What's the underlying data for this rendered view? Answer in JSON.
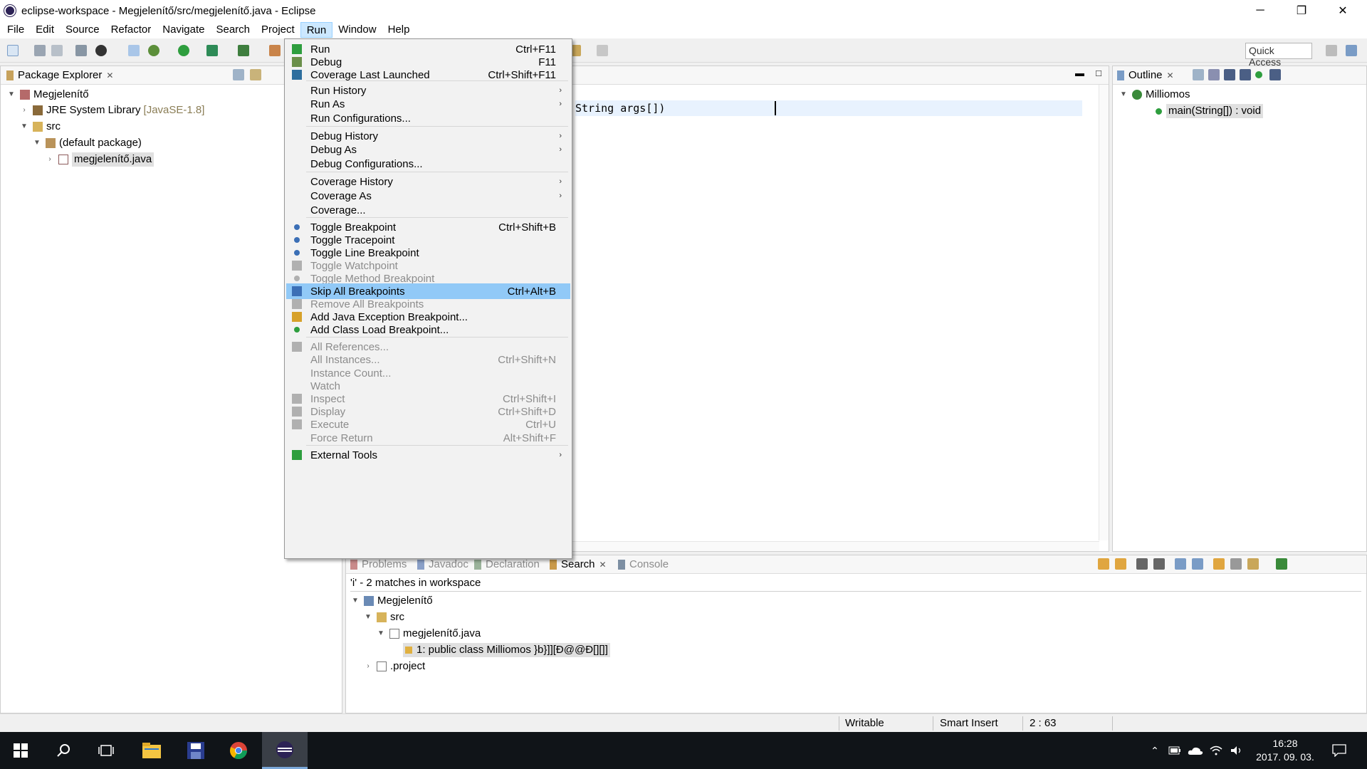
{
  "window": {
    "title": "eclipse-workspace - Megjelenítő/src/megjelenítő.java - Eclipse",
    "minimize": "─",
    "maximize": "❐",
    "close": "✕"
  },
  "menubar": [
    "File",
    "Edit",
    "Source",
    "Refactor",
    "Navigate",
    "Search",
    "Project",
    "Run",
    "Window",
    "Help"
  ],
  "toolbar": {
    "quick_access": "Quick Access"
  },
  "package_explorer": {
    "tab": "Package Explorer",
    "tree": {
      "project": "Megjelenítő",
      "jre": "JRE System Library",
      "jre_version": "[JavaSE-1.8]",
      "src": "src",
      "package": "(default package)",
      "file": "megjelenítő.java"
    }
  },
  "editor": {
    "visible_code": "String args[])"
  },
  "outline": {
    "tab": "Outline",
    "class": "Milliomos",
    "method": "main(String[]) : void"
  },
  "bottom_panel": {
    "tabs": [
      "Problems",
      "Javadoc",
      "Declaration",
      "Search",
      "Console"
    ],
    "summary": "'i' - 2 matches in workspace",
    "tree": {
      "project": "Megjelenítő",
      "src": "src",
      "file": "megjelenítő.java",
      "match": "1: public class Milliomos }b}]][Ð@@Ð[][]]",
      "project_file": ".project"
    }
  },
  "status": {
    "writable": "Writable",
    "insert_mode": "Smart Insert",
    "position": "2 : 63"
  },
  "run_menu": {
    "items": [
      {
        "label": "Run",
        "accel": "Ctrl+F11",
        "icon": "run-icon"
      },
      {
        "label": "Debug",
        "accel": "F11",
        "icon": "debug-icon"
      },
      {
        "label": "Coverage Last Launched",
        "accel": "Ctrl+Shift+F11",
        "icon": "coverage-icon"
      },
      {
        "label": "Run History",
        "submenu": true
      },
      {
        "label": "Run As",
        "submenu": true
      },
      {
        "label": "Run Configurations..."
      },
      {
        "label": "Debug History",
        "submenu": true
      },
      {
        "label": "Debug As",
        "submenu": true
      },
      {
        "label": "Debug Configurations..."
      },
      {
        "label": "Coverage History",
        "submenu": true
      },
      {
        "label": "Coverage As",
        "submenu": true
      },
      {
        "label": "Coverage..."
      },
      {
        "label": "Toggle Breakpoint",
        "accel": "Ctrl+Shift+B",
        "icon": "breakpoint-icon"
      },
      {
        "label": "Toggle Tracepoint",
        "icon": "tracepoint-icon"
      },
      {
        "label": "Toggle Line Breakpoint",
        "icon": "line-breakpoint-icon"
      },
      {
        "label": "Toggle Watchpoint",
        "disabled": true,
        "icon": "watchpoint-icon"
      },
      {
        "label": "Toggle Method Breakpoint",
        "disabled": true,
        "icon": "method-breakpoint-icon"
      },
      {
        "label": "Skip All Breakpoints",
        "accel": "Ctrl+Alt+B",
        "highlighted": true,
        "icon": "skip-breakpoints-icon"
      },
      {
        "label": "Remove All Breakpoints",
        "disabled": true,
        "icon": "remove-breakpoints-icon"
      },
      {
        "label": "Add Java Exception Breakpoint...",
        "icon": "exception-breakpoint-icon"
      },
      {
        "label": "Add Class Load Breakpoint...",
        "icon": "class-load-breakpoint-icon"
      },
      {
        "label": "All References...",
        "disabled": true,
        "icon": "references-icon"
      },
      {
        "label": "All Instances...",
        "accel": "Ctrl+Shift+N",
        "disabled": true
      },
      {
        "label": "Instance Count...",
        "disabled": true
      },
      {
        "label": "Watch",
        "disabled": true
      },
      {
        "label": "Inspect",
        "accel": "Ctrl+Shift+I",
        "disabled": true,
        "icon": "inspect-icon"
      },
      {
        "label": "Display",
        "accel": "Ctrl+Shift+D",
        "disabled": true,
        "icon": "display-icon"
      },
      {
        "label": "Execute",
        "accel": "Ctrl+U",
        "disabled": true,
        "icon": "execute-icon"
      },
      {
        "label": "Force Return",
        "accel": "Alt+Shift+F",
        "disabled": true
      },
      {
        "label": "External Tools",
        "submenu": true,
        "icon": "external-tools-icon"
      }
    ]
  },
  "taskbar": {
    "time": "16:28",
    "date": "2017. 09. 03."
  },
  "colors": {
    "menu_highlight": "#91c9f7",
    "menubar_active": "#cce8ff",
    "taskbar": "#101418"
  }
}
